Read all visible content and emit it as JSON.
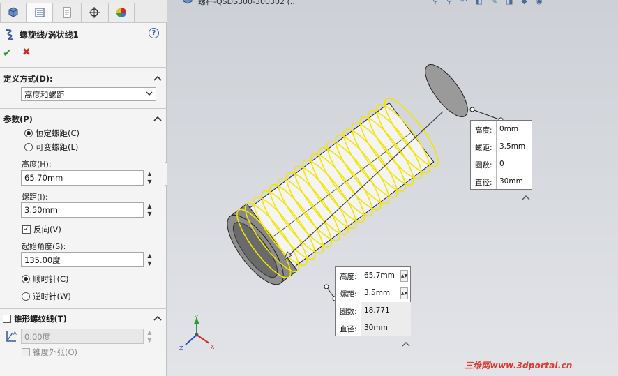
{
  "doc": {
    "title": "螺杆-QSDS300-300302 (..."
  },
  "panel": {
    "tabs": [
      {
        "icon": "feature-manager-icon"
      },
      {
        "icon": "property-manager-icon"
      },
      {
        "icon": "configuration-manager-icon"
      },
      {
        "icon": "dimxpert-icon"
      },
      {
        "icon": "display-manager-icon"
      }
    ],
    "title": "螺旋线/涡状线1",
    "help": "?",
    "definition": {
      "header": "定义方式(D):",
      "selected": "高度和螺距"
    },
    "params": {
      "header": "参数(P)",
      "radio_constant": "恒定螺距(C)",
      "radio_variable": "可变螺距(L)",
      "height_label": "高度(H):",
      "height_value": "65.70mm",
      "pitch_label": "螺距(I):",
      "pitch_value": "3.50mm",
      "reverse_label": "反向(V)",
      "start_angle_label": "起始角度(S):",
      "start_angle_value": "135.00度",
      "cw_label": "顺时针(C)",
      "ccw_label": "逆时针(W)"
    },
    "taper": {
      "header": "锥形螺纹线(T)",
      "angle_value": "0.00度",
      "taper_outward_label": "锥度外张(O)"
    }
  },
  "callout_top": {
    "rows": [
      {
        "key": "高度:",
        "value": "0mm"
      },
      {
        "key": "螺距:",
        "value": "3.5mm"
      },
      {
        "key": "圈数:",
        "value": "0"
      },
      {
        "key": "直径:",
        "value": "30mm"
      }
    ]
  },
  "callout_bottom": {
    "rows": [
      {
        "key": "高度:",
        "value": "65.7mm"
      },
      {
        "key": "螺距:",
        "value": "3.5mm"
      },
      {
        "key": "圈数:",
        "value": "18.771"
      },
      {
        "key": "直径:",
        "value": "30mm"
      }
    ]
  },
  "triad": {
    "x": "X",
    "y": "Y",
    "z": "Z"
  },
  "watermark": "三维网www.3dportal.cn",
  "colors": {
    "helix": "#f2e600",
    "accept": "#2f9a2f",
    "cancel": "#c92a2a",
    "watermark": "#e03a2e"
  }
}
